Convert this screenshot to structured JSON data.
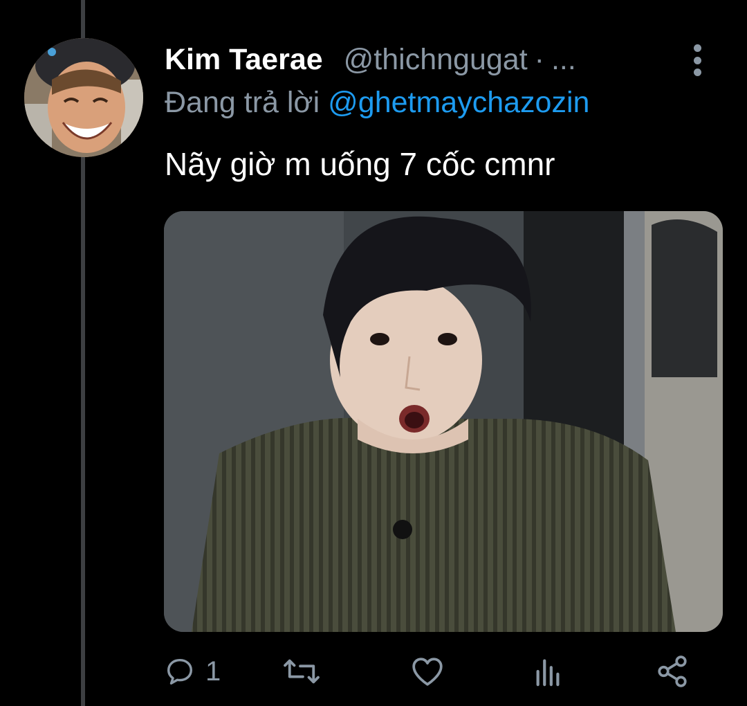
{
  "tweet": {
    "display_name": "Kim Taerae",
    "handle": "@thichngugat",
    "separator": "·",
    "ellipsis": "...",
    "reply_prefix": "Đang trả lời",
    "reply_target": "@ghetmaychazozin",
    "text": "Nãy giờ m uống 7 cốc cmnr"
  },
  "actions": {
    "reply_icon": "reply-icon",
    "reply_count": "1",
    "retweet_icon": "retweet-icon",
    "like_icon": "heart-icon",
    "analytics_icon": "analytics-icon",
    "share_icon": "share-icon"
  },
  "colors": {
    "background": "#000000",
    "text_primary": "#ffffff",
    "text_secondary": "#8b98a5",
    "link": "#1d9bf0",
    "thread_line": "#3d3f42"
  }
}
